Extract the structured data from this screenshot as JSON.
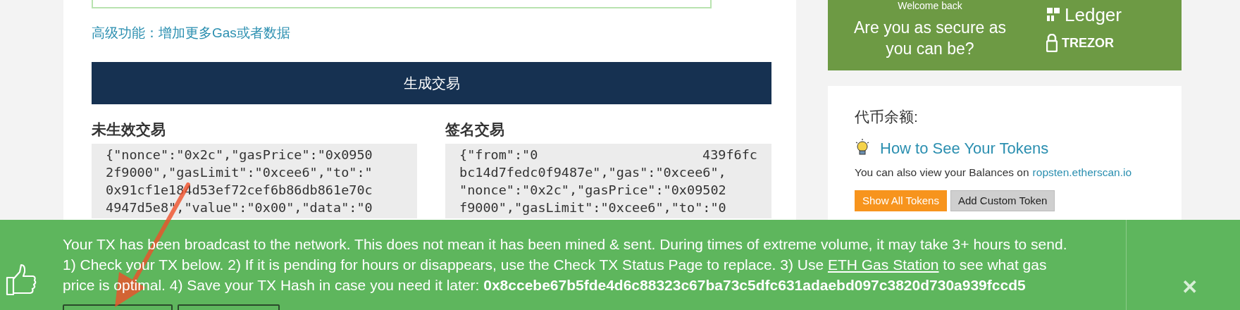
{
  "main": {
    "advanced_link": "高级功能：增加更多Gas或者数据",
    "generate_button": "生成交易",
    "raw_tx": {
      "heading": "未生效交易",
      "lines": [
        "{\"nonce\":\"0x2c\",\"gasPrice\":\"0x0950",
        "2f9000\",\"gasLimit\":\"0xcee6\",\"to\":\"",
        "0x91cf1e184d53ef72cef6b86db861e70c",
        "4947d5e8\",\"value\":\"0x00\",\"data\":\"0"
      ]
    },
    "signed_tx": {
      "heading": "签名交易",
      "first_line_start": "{\"from\":\"0",
      "first_line_end": "439f6fc",
      "lines": [
        "bc14d7fedc0f9487e\",\"gas\":\"0xcee6\",",
        "\"nonce\":\"0x2c\",\"gasPrice\":\"0x09502",
        "f9000\",\"gasLimit\":\"0xcee6\",\"to\":\"0"
      ]
    }
  },
  "sidebar": {
    "promo": {
      "kicker": "Welcome back",
      "headline": "Are you as secure as you can be?",
      "brands": [
        "Ledger",
        "TREZOR"
      ]
    },
    "tokens": {
      "title": "代币余额:",
      "help_link": "How to See Your Tokens",
      "note": "You can also view your Balances on",
      "note_link": "ropsten.etherscan.io",
      "buttons": [
        {
          "label": "Show All Tokens",
          "kind": "primary"
        },
        {
          "label": "Add Custom Token",
          "kind": "secondary"
        }
      ]
    }
  },
  "alert": {
    "text_before_link": "Your TX has been broadcast to the network. This does not mean it has been mined & sent. During times of extreme volume, it may take 3+ hours to send. 1) Check your TX below. 2) If it is pending for hours or disappears, use the Check TX Status Page to replace. 3) Use",
    "link": "ETH Gas Station",
    "text_after_link": "to see what gas price is optimal. 4) Save your TX Hash in case you need it later: **0x8ccebe67b5fde4d6c88323c67ba73c5dfc631adaebd097c3820d730a939fccd5**",
    "close": "✕"
  }
}
